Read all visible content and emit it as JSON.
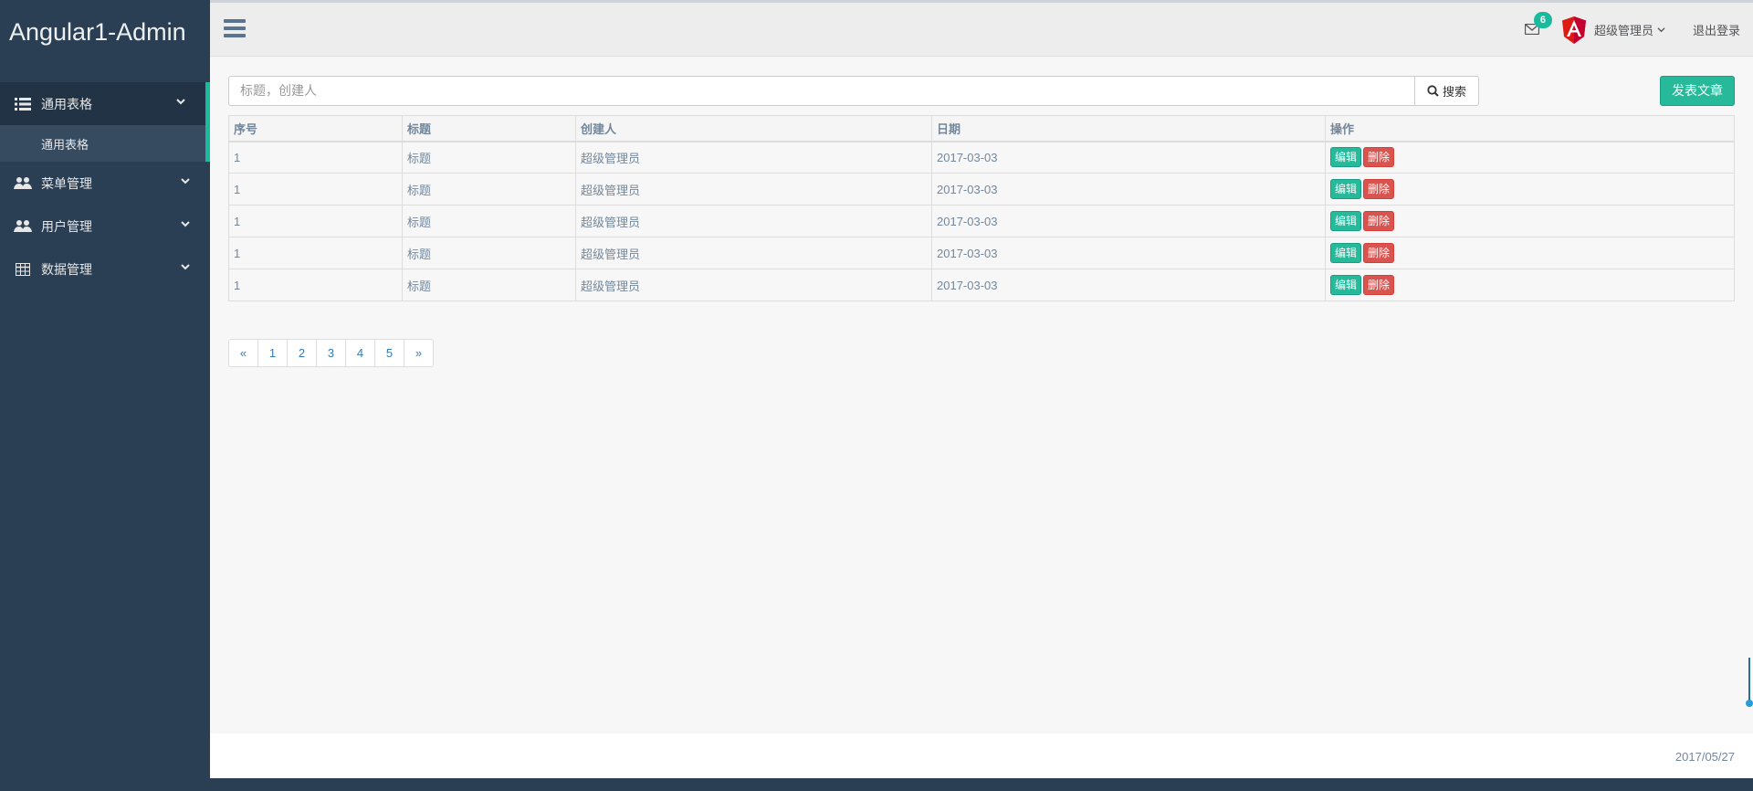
{
  "app": {
    "title": "Angular1-Admin"
  },
  "sidebar": {
    "items": [
      {
        "label": "通用表格",
        "icon": "list-icon"
      },
      {
        "label": "菜单管理",
        "icon": "users-icon"
      },
      {
        "label": "用户管理",
        "icon": "users-icon"
      },
      {
        "label": "数据管理",
        "icon": "table-icon"
      }
    ],
    "submenu": {
      "label": "通用表格"
    }
  },
  "header": {
    "mail_count": "6",
    "user_name": "超级管理员",
    "logout_label": "退出登录"
  },
  "search": {
    "placeholder": "标题，创建人",
    "button_label": "搜索"
  },
  "actions": {
    "publish_label": "发表文章"
  },
  "table": {
    "columns": [
      "序号",
      "标题",
      "创建人",
      "日期",
      "操作"
    ],
    "rows": [
      {
        "id": "1",
        "title": "标题",
        "creator": "超级管理员",
        "date": "2017-03-03"
      },
      {
        "id": "1",
        "title": "标题",
        "creator": "超级管理员",
        "date": "2017-03-03"
      },
      {
        "id": "1",
        "title": "标题",
        "creator": "超级管理员",
        "date": "2017-03-03"
      },
      {
        "id": "1",
        "title": "标题",
        "creator": "超级管理员",
        "date": "2017-03-03"
      },
      {
        "id": "1",
        "title": "标题",
        "creator": "超级管理员",
        "date": "2017-03-03"
      }
    ],
    "edit_label": "编辑",
    "delete_label": "删除"
  },
  "pagination": [
    "«",
    "1",
    "2",
    "3",
    "4",
    "5",
    "»"
  ],
  "footer": {
    "date": "2017/05/27"
  },
  "colors": {
    "sidebar_bg": "#2a3f54",
    "accent": "#1abb9c",
    "danger": "#d9534f"
  }
}
